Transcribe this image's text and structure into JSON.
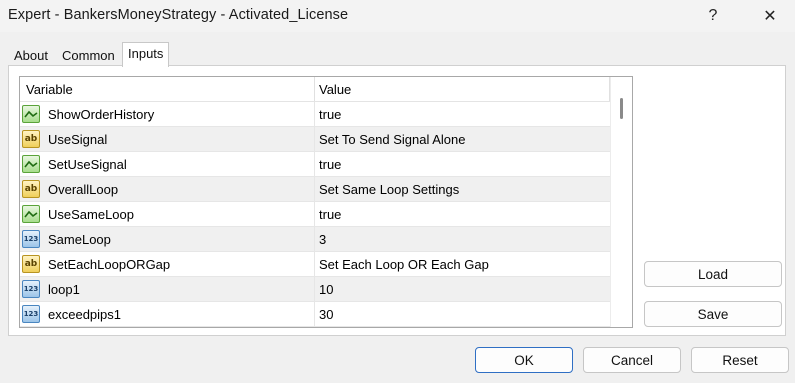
{
  "window": {
    "title": "Expert - BankersMoneyStrategy  -  Activated_License",
    "help_label": "?",
    "close_label": "✕"
  },
  "tabs": [
    {
      "label": "About"
    },
    {
      "label": "Common"
    },
    {
      "label": "Inputs",
      "active": true
    }
  ],
  "grid": {
    "columns": {
      "variable": "Variable",
      "value": "Value"
    },
    "rows": [
      {
        "icon": "bool-icon",
        "name": "ShowOrderHistory",
        "value": "true"
      },
      {
        "icon": "string-icon",
        "icon_text": "ab",
        "name": "UseSignal",
        "value": "Set To Send Signal Alone"
      },
      {
        "icon": "bool-icon",
        "name": "SetUseSignal",
        "value": "true"
      },
      {
        "icon": "string-icon",
        "icon_text": "ab",
        "name": "OverallLoop",
        "value": "Set Same Loop Settings"
      },
      {
        "icon": "bool-icon",
        "name": "UseSameLoop",
        "value": "true"
      },
      {
        "icon": "number-icon",
        "icon_text": "123",
        "name": "SameLoop",
        "value": "3"
      },
      {
        "icon": "string-icon",
        "icon_text": "ab",
        "name": "SetEachLoopORGap",
        "value": "Set Each Loop OR Each Gap"
      },
      {
        "icon": "number-icon",
        "icon_text": "123",
        "name": "loop1",
        "value": "10"
      },
      {
        "icon": "number-icon",
        "icon_text": "123",
        "name": "exceedpips1",
        "value": "30"
      }
    ]
  },
  "buttons": {
    "load": "Load",
    "save": "Save",
    "ok": "OK",
    "cancel": "Cancel",
    "reset": "Reset"
  },
  "colors": {
    "accent": "#2f6fc4",
    "bool_icon": "#5aa33a",
    "string_icon": "#f0cf5a",
    "number_icon": "#4a86c0"
  }
}
